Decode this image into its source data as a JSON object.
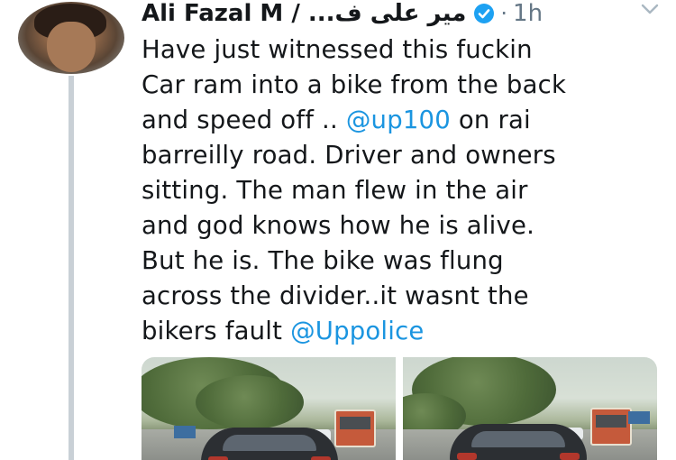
{
  "tweet": {
    "author": {
      "display_name": "Ali Fazal M / ...میر علی ف",
      "verified_icon": "verified-badge-icon"
    },
    "separator": "·",
    "timestamp": "1h",
    "menu_icon": "chevron-down-icon",
    "text": {
      "part1": "Have just witnessed this fuckin\nCar ram into a bike from the back\nand speed off .. ",
      "mention1": "@up100",
      "part2": " on rai\nbarreilly road. Driver and owners\nsitting. The man flew in the air\nand god knows how he is alive.\nBut he is. The bike was flung\nacross the divider..it wasnt the\nbikers fault ",
      "mention2": "@Uppolice"
    },
    "media_count": 2
  },
  "colors": {
    "link": "#1b95e0",
    "verified": "#1da1f2",
    "muted": "#657786",
    "thread_line": "#c9d0d6"
  }
}
